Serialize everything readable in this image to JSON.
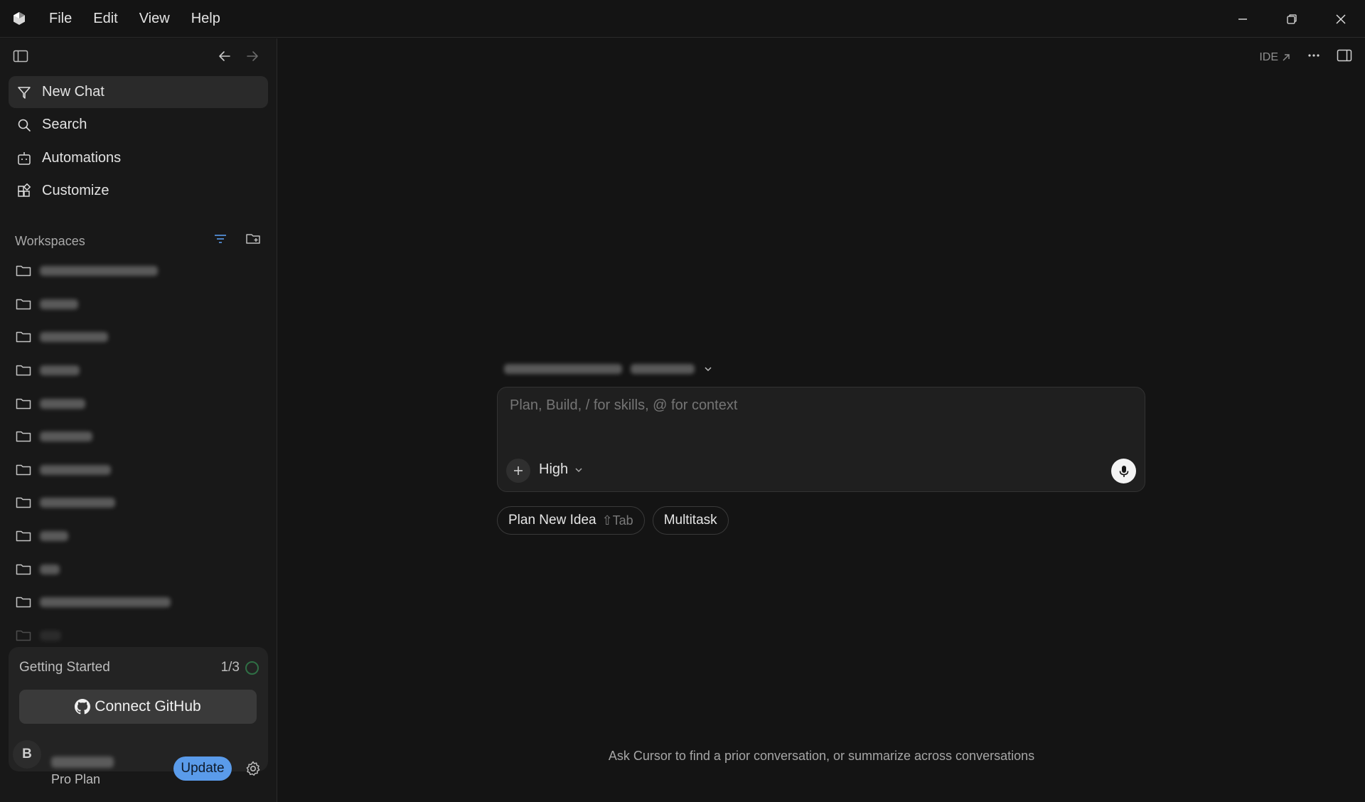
{
  "titlebar": {
    "menu": [
      "File",
      "Edit",
      "View",
      "Help"
    ]
  },
  "sidebar": {
    "nav": [
      {
        "label": "New Chat",
        "icon": "new-chat-icon",
        "active": true
      },
      {
        "label": "Search",
        "icon": "search-icon"
      },
      {
        "label": "Automations",
        "icon": "automations-icon"
      },
      {
        "label": "Customize",
        "icon": "customize-icon"
      }
    ],
    "workspaces_label": "Workspaces",
    "getting_started": {
      "title": "Getting Started",
      "progress": "1/3",
      "connect_label": "Connect GitHub"
    },
    "user": {
      "initial": "B",
      "plan": "Pro Plan",
      "update_label": "Update"
    }
  },
  "main": {
    "ide_label": "IDE",
    "composer": {
      "placeholder": "Plan, Build, / for skills, @ for context",
      "mode": "High"
    },
    "chips": [
      {
        "label": "Plan New Idea",
        "hint": "⇧Tab"
      },
      {
        "label": "Multitask"
      }
    ],
    "footer_hint": "Ask Cursor to find a prior conversation, or summarize across conversations"
  },
  "colors": {
    "background": "#141414",
    "sidebar": "#181818",
    "accent": "#5a9bea"
  }
}
